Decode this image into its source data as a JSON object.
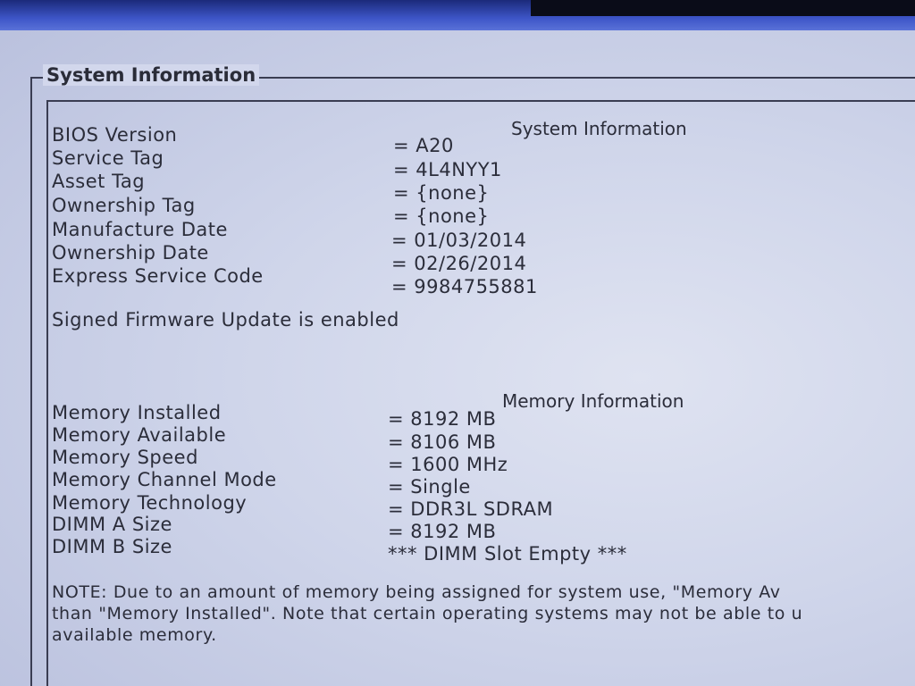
{
  "group_title": "System Information",
  "system": {
    "title": "System Information",
    "rows": [
      {
        "label": "BIOS Version",
        "value": "= A20"
      },
      {
        "label": "Service Tag",
        "value": "= 4L4NYY1"
      },
      {
        "label": "Asset Tag",
        "value": "= {none}"
      },
      {
        "label": "Ownership Tag",
        "value": "= {none}"
      },
      {
        "label": "Manufacture Date",
        "value": "= 01/03/2014"
      },
      {
        "label": "Ownership Date",
        "value": "= 02/26/2014"
      },
      {
        "label": "Express Service Code",
        "value": "= 9984755881"
      }
    ],
    "firmware_note": "Signed Firmware Update is enabled"
  },
  "memory": {
    "title": "Memory Information",
    "rows": [
      {
        "label": "Memory Installed",
        "value": "= 8192 MB"
      },
      {
        "label": "Memory Available",
        "value": "= 8106 MB"
      },
      {
        "label": "Memory Speed",
        "value": "= 1600 MHz"
      },
      {
        "label": "Memory Channel Mode",
        "value": "= Single"
      },
      {
        "label": "Memory Technology",
        "value": "= DDR3L SDRAM"
      },
      {
        "label": "DIMM A Size",
        "value": "= 8192 MB"
      },
      {
        "label": "DIMM B Size",
        "value": "*** DIMM Slot Empty ***"
      }
    ],
    "note_lines": [
      "NOTE: Due to an amount of memory being assigned for system use, \"Memory Av",
      "than \"Memory Installed\". Note that certain operating systems may not be able to u",
      "available memory."
    ]
  }
}
